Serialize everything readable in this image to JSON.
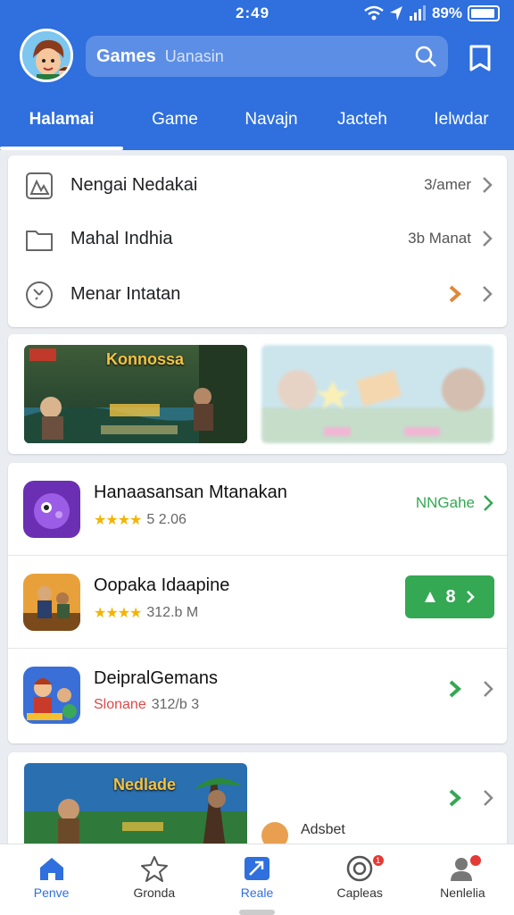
{
  "status": {
    "time": "2:49",
    "battery": "89%"
  },
  "header": {
    "search_label": "Games",
    "search_placeholder": "Uanasin",
    "tabs": [
      {
        "label": "Halamai",
        "active": true
      },
      {
        "label": "Game"
      },
      {
        "label": "Navajn"
      },
      {
        "label": "Jacteh"
      },
      {
        "label": "Ielwdar"
      }
    ]
  },
  "menu": {
    "items": [
      {
        "label": "Nengai Nedakai",
        "value": "3/amer",
        "icon": "image-icon"
      },
      {
        "label": "Mahal Indhia",
        "value": "3b Manat",
        "icon": "folder-icon"
      },
      {
        "label": "Menar Intatan",
        "value": "",
        "icon": "settings-dial-icon"
      }
    ]
  },
  "banner": {
    "title": "Konnossa"
  },
  "apps": [
    {
      "title": "Hanaasansan Mtanakan",
      "rating": "★★★★",
      "meta": "5 2.06",
      "action": "NNGahe"
    },
    {
      "title": "Oopaka Idaapine",
      "rating": "★★★★",
      "meta": "312.b M",
      "action": "8"
    },
    {
      "title": "DeipralGemans",
      "meta_prefix": "Slonane",
      "meta": "312/b 3",
      "action": ""
    }
  ],
  "feature": {
    "title": "Nedlade",
    "avatar_label": "Adsbet"
  },
  "bottom_nav": [
    {
      "label": "Penve",
      "icon": "home-icon",
      "active": false
    },
    {
      "label": "Gronda",
      "icon": "star-icon",
      "active": false
    },
    {
      "label": "Reale",
      "icon": "trending-icon",
      "active": true
    },
    {
      "label": "Capleas",
      "icon": "target-icon",
      "badge": "1"
    },
    {
      "label": "Nenlelia",
      "icon": "person-icon",
      "badge": ""
    }
  ],
  "colors": {
    "primary": "#2f6fde",
    "accent_green": "#34a853",
    "star": "#f4b400",
    "orange": "#e0883a"
  }
}
